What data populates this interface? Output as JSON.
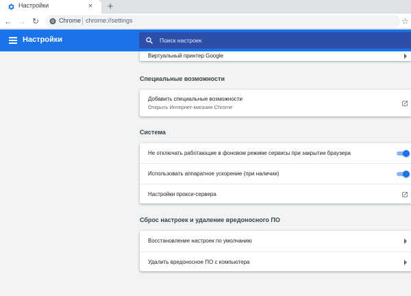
{
  "tab": {
    "title": "Настройки",
    "close_glyph": "×",
    "new_tab_glyph": "+"
  },
  "toolbar": {
    "back_glyph": "←",
    "forward_glyph": "→",
    "reload_glyph": "↻",
    "site_chip": "Chrome",
    "url": "chrome://settings",
    "star_glyph": "☆"
  },
  "header": {
    "title": "Настройки",
    "search_placeholder": "Поиск настроек"
  },
  "colors": {
    "accent": "#1a73e8",
    "search_bg": "#2c4fab",
    "page_bg": "#f1f3f4"
  },
  "content": {
    "partial_row": "Виртуальный принтер Google",
    "accessibility": {
      "title": "Специальные возможности",
      "item_label": "Добавить специальные возможности",
      "item_sub": "Открыть Интернет-магазин Chrome",
      "item_icon": "external-link-icon"
    },
    "system": {
      "title": "Система",
      "rows": [
        {
          "label": "Не отключать работающие в фоновом режиме сервисы при закрытии браузера",
          "control": "toggle",
          "on": true
        },
        {
          "label": "Использовать аппаратное ускорение (при наличии)",
          "control": "toggle",
          "on": true
        },
        {
          "label": "Настройки прокси-сервера",
          "control": "external-link-icon"
        }
      ]
    },
    "reset": {
      "title": "Сброс настроек и удаление вредоносного ПО",
      "rows": [
        {
          "label": "Восстановление настроек по умолчанию",
          "control": "chevron-right-icon"
        },
        {
          "label": "Удалить вредоносное ПО с компьютера",
          "control": "chevron-right-icon"
        }
      ]
    }
  }
}
